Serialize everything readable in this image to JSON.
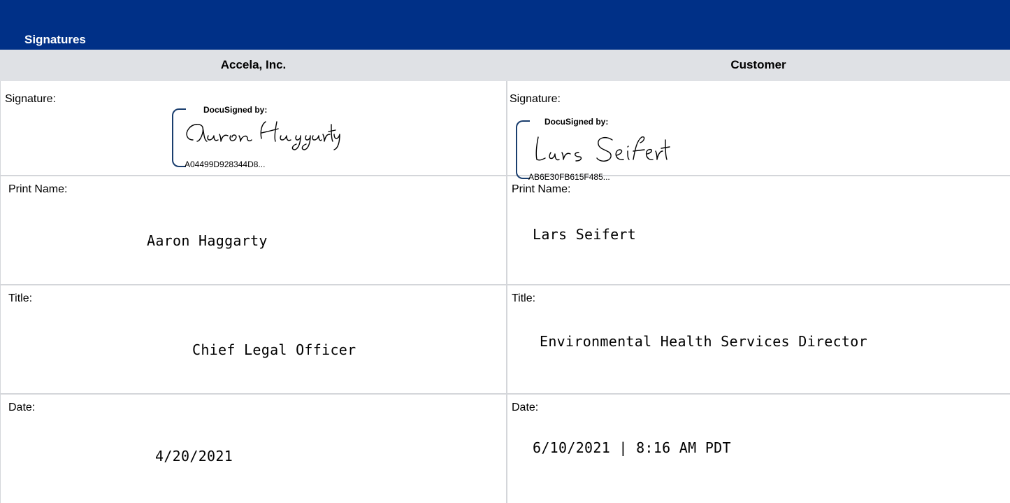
{
  "section": {
    "title": "Signatures"
  },
  "columns": {
    "left": "Accela, Inc.",
    "right": "Customer"
  },
  "left": {
    "signature_label": "Signature:",
    "docusign_label": "DocuSigned by:",
    "docusign_id": "A04499D928344D8...",
    "signature_name": "Aaron Haggarty",
    "print_name_label": "Print Name:",
    "print_name": "Aaron Haggarty",
    "title_label": "Title:",
    "title": "Chief Legal Officer",
    "date_label": "Date:",
    "date": "4/20/2021"
  },
  "right": {
    "signature_label": "Signature:",
    "docusign_label": "DocuSigned by:",
    "docusign_id": "AB6E30FB615F485...",
    "signature_name": "Lars Seifert",
    "print_name_label": "Print Name:",
    "print_name": "Lars Seifert",
    "title_label": "Title:",
    "title": "Environmental Health Services Director",
    "date_label": "Date:",
    "date": "6/10/2021 | 8:16 AM PDT"
  },
  "colors": {
    "header": "#003087",
    "column_header": "#dfe1e5",
    "grid": "#d4d6da",
    "docusign_bracket": "#1a3e6e"
  }
}
